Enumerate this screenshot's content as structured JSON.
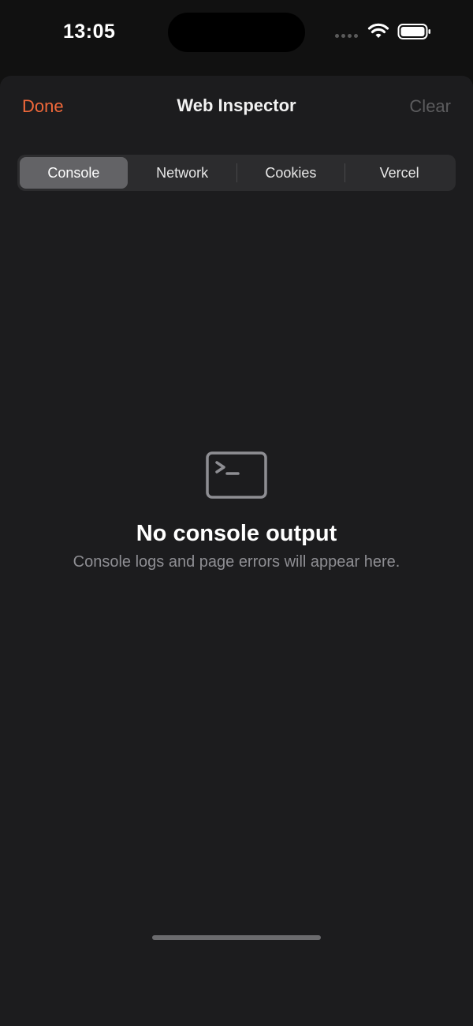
{
  "status_bar": {
    "time": "13:05",
    "icons": [
      "cellular-signal-icon",
      "wifi-icon",
      "battery-icon"
    ]
  },
  "nav": {
    "done_label": "Done",
    "title": "Web Inspector",
    "clear_label": "Clear"
  },
  "tabs": [
    {
      "label": "Console",
      "selected": true
    },
    {
      "label": "Network",
      "selected": false
    },
    {
      "label": "Cookies",
      "selected": false
    },
    {
      "label": "Vercel",
      "selected": false
    }
  ],
  "empty_state": {
    "icon": "terminal-icon",
    "title": "No console output",
    "subtitle": "Console logs and page errors will appear here."
  },
  "colors": {
    "accent": "#f0683a",
    "sheet_background": "#1c1c1e",
    "segment_selected": "#636366",
    "disabled_text": "#5c5c5e"
  }
}
